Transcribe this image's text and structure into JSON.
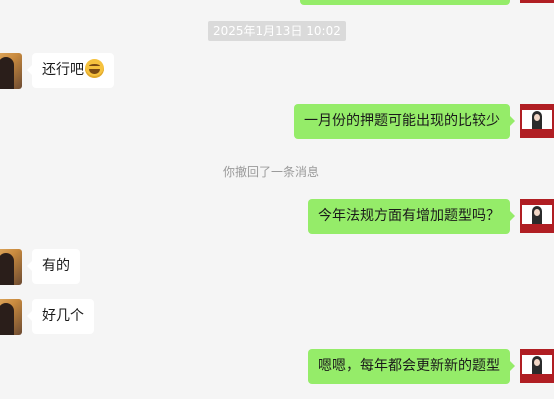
{
  "chat": {
    "timestamp": "2025年1月13日 10:02",
    "system_note": "你撤回了一条消息",
    "messages": [
      {
        "side": "left",
        "text": "还行吧",
        "emoji": "grinning-sweat-emoji"
      },
      {
        "side": "right",
        "text": "一月份的押题可能出现的比较少"
      },
      {
        "side": "right",
        "text": "今年法规方面有增加题型吗？"
      },
      {
        "side": "left",
        "text": "有的"
      },
      {
        "side": "left",
        "text": "好几个"
      },
      {
        "side": "right",
        "text": "嗯嗯，每年都会更新新的题型"
      }
    ]
  },
  "colors": {
    "background": "#f5f5f5",
    "incoming_bubble": "#ffffff",
    "outgoing_bubble": "#95ec69",
    "timestamp_bg": "#dadada",
    "system_text": "#9a9a9a",
    "avatar_frame": "#b01e23"
  }
}
